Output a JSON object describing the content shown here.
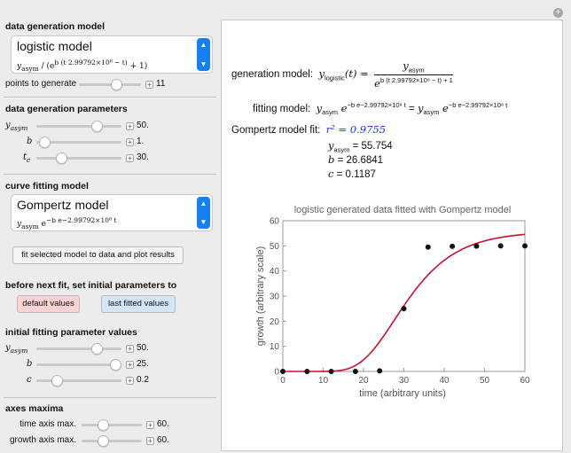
{
  "window": {
    "corner_icon": "+"
  },
  "controls": {
    "data_generation_model": {
      "heading": "data generation model",
      "selected": "logistic model",
      "formula_lead": "y",
      "formula_sub": "asym",
      "formula_rest": " / (e",
      "formula_exp": "b (t 2.99792×10⁸ − t)",
      "formula_tail": " + 1)"
    },
    "points": {
      "label": "points to generate",
      "value": "11",
      "fraction": 0.63
    },
    "data_generation_parameters": {
      "heading": "data generation parameters",
      "rows": [
        {
          "label": "y",
          "sub": "asym",
          "value": "50.",
          "fraction": 0.75
        },
        {
          "label": "b",
          "sub": "",
          "value": "1.",
          "fraction": 0.04
        },
        {
          "label": "t",
          "sub": "c",
          "value": "30.",
          "fraction": 0.27
        }
      ]
    },
    "curve_fitting_model": {
      "heading": "curve fitting model",
      "selected": "Gompertz model",
      "formula_lead": "y",
      "formula_sub": "asym",
      "formula_rest": " e",
      "formula_exp": "−b e−2.99792×10⁸ t"
    },
    "fit_button": "fit selected model to data and plot results",
    "before_next_fit": {
      "heading": "before next fit, set initial parameters to",
      "default_button": "default values",
      "last_button": "last fitted values"
    },
    "initial_fitting": {
      "heading": "initial fitting parameter values",
      "rows": [
        {
          "label": "y",
          "sub": "asym",
          "value": "50.",
          "fraction": 0.75
        },
        {
          "label": "b",
          "sub": "",
          "value": "25.",
          "fraction": 1.0
        },
        {
          "label": "c",
          "sub": "",
          "value": "0.2",
          "fraction": 0.2
        }
      ]
    },
    "axes_maxima": {
      "heading": "axes maxima",
      "rows": [
        {
          "label": "time axis max.",
          "value": "60.",
          "fraction": 0.33
        },
        {
          "label": "growth axis max.",
          "value": "60.",
          "fraction": 0.33
        }
      ]
    }
  },
  "output": {
    "generation_label": "generation model:",
    "generation_lhs": "y",
    "generation_lhs_sub": "logistic",
    "generation_lhs_arg": "(t) =",
    "generation_num": "y",
    "generation_num_sub": "asym",
    "generation_den": "e",
    "generation_den_exp": "b (t 2.99792×10⁸ − t) + 1",
    "fitting_label": "fitting model:",
    "fitting_lhs": "y",
    "fitting_sub": "asym",
    "fitting_e": " e",
    "fitting_exp": "−b e−2.99792×10⁸ t",
    "fitting_eq": " = ",
    "gompertz_label": "Gompertz model fit:",
    "r2": "r² = 0.9755",
    "fit_values": [
      {
        "sym": "y",
        "sub": "asym",
        "text": " = 55.754"
      },
      {
        "sym": "b",
        "sub": "",
        "text": " = 26.6841"
      },
      {
        "sym": "c",
        "sub": "",
        "text": " = 0.1187"
      }
    ]
  },
  "colors": {
    "accent": "#1580f4",
    "r2": "#1f2ef0",
    "curve": "#c8102e",
    "default_btn": "#fbd3d3",
    "last_btn": "#d2e6f8"
  },
  "chart_data": {
    "type": "scatter",
    "title": "logistic generated data fitted with Gompertz model",
    "xlabel": "time (arbitrary units)",
    "ylabel": "growth (arbitrary scale)",
    "xlim": [
      0,
      60
    ],
    "ylim": [
      0,
      60
    ],
    "xticks": [
      0,
      10,
      20,
      30,
      40,
      50,
      60
    ],
    "yticks": [
      0,
      10,
      20,
      30,
      40,
      50,
      60
    ],
    "points": [
      {
        "x": 0,
        "y": 0
      },
      {
        "x": 6,
        "y": 0
      },
      {
        "x": 12,
        "y": 0
      },
      {
        "x": 18,
        "y": 0
      },
      {
        "x": 24,
        "y": 0.2
      },
      {
        "x": 30,
        "y": 25
      },
      {
        "x": 36,
        "y": 49.5
      },
      {
        "x": 42,
        "y": 49.8
      },
      {
        "x": 48,
        "y": 49.9
      },
      {
        "x": 54,
        "y": 50
      },
      {
        "x": 60,
        "y": 50
      }
    ],
    "fit": {
      "yasym": 55.754,
      "b": 26.6841,
      "c": 0.1187
    }
  }
}
